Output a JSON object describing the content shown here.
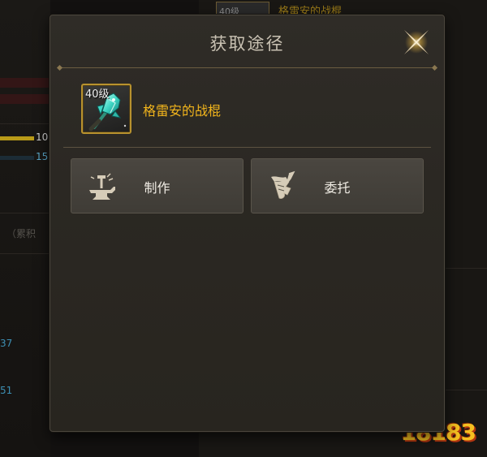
{
  "dialog": {
    "title": "获取途径",
    "item": {
      "level": "40级",
      "name": "格雷安的战棍"
    },
    "buttons": [
      {
        "label": "制作",
        "icon": "anvil-hammer-icon"
      },
      {
        "label": "委托",
        "icon": "scroll-quill-icon"
      }
    ]
  },
  "background": {
    "item_badge": "40级",
    "item_name": "格雷安的战棍",
    "left_values": [
      "10",
      "15"
    ],
    "left_note": "（累积",
    "left_numbers": [
      "37",
      "51"
    ]
  },
  "watermark": "18183",
  "colors": {
    "item_name": "#f2b51c",
    "item_frame": "#b8922e",
    "title": "#c9c2b3",
    "button_bg": "#46423c"
  }
}
